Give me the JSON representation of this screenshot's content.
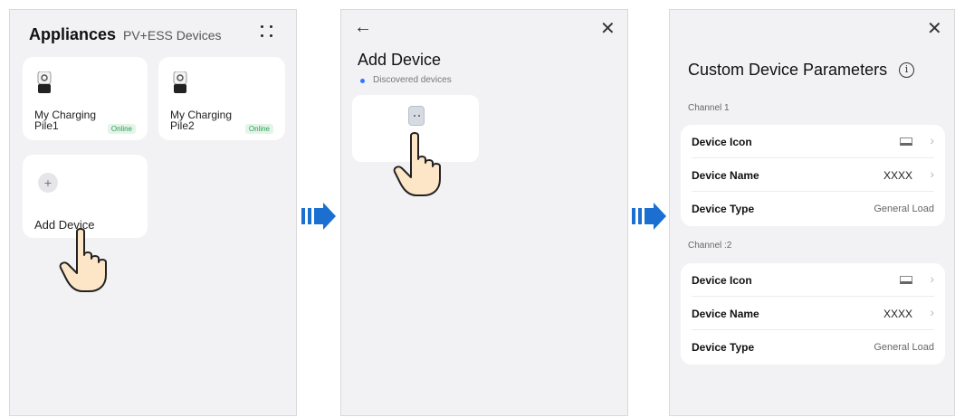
{
  "panel1": {
    "title": "Appliances",
    "subtitle": "PV+ESS Devices",
    "cards": [
      {
        "name": "My Charging Pile1",
        "status": "Online"
      },
      {
        "name": "My Charging Pile2",
        "status": "Online"
      }
    ],
    "add_label": "Add Device"
  },
  "panel2": {
    "title": "Add Device",
    "section": "Discovered devices"
  },
  "panel3": {
    "title": "Custom Device Parameters",
    "channels": [
      {
        "label": "Channel 1",
        "rows": [
          {
            "label": "Device Icon",
            "value": ""
          },
          {
            "label": "Device Name",
            "value": "XXXX"
          },
          {
            "label": "Device Type",
            "value": "General Load"
          }
        ]
      },
      {
        "label": "Channel :2",
        "rows": [
          {
            "label": "Device Icon",
            "value": ""
          },
          {
            "label": "Device Name",
            "value": "XXXX"
          },
          {
            "label": "Device Type",
            "value": "General Load"
          }
        ]
      }
    ]
  },
  "colors": {
    "accent": "#1a6fd1",
    "online": "#2e9e55",
    "dot": "#3377ff"
  }
}
